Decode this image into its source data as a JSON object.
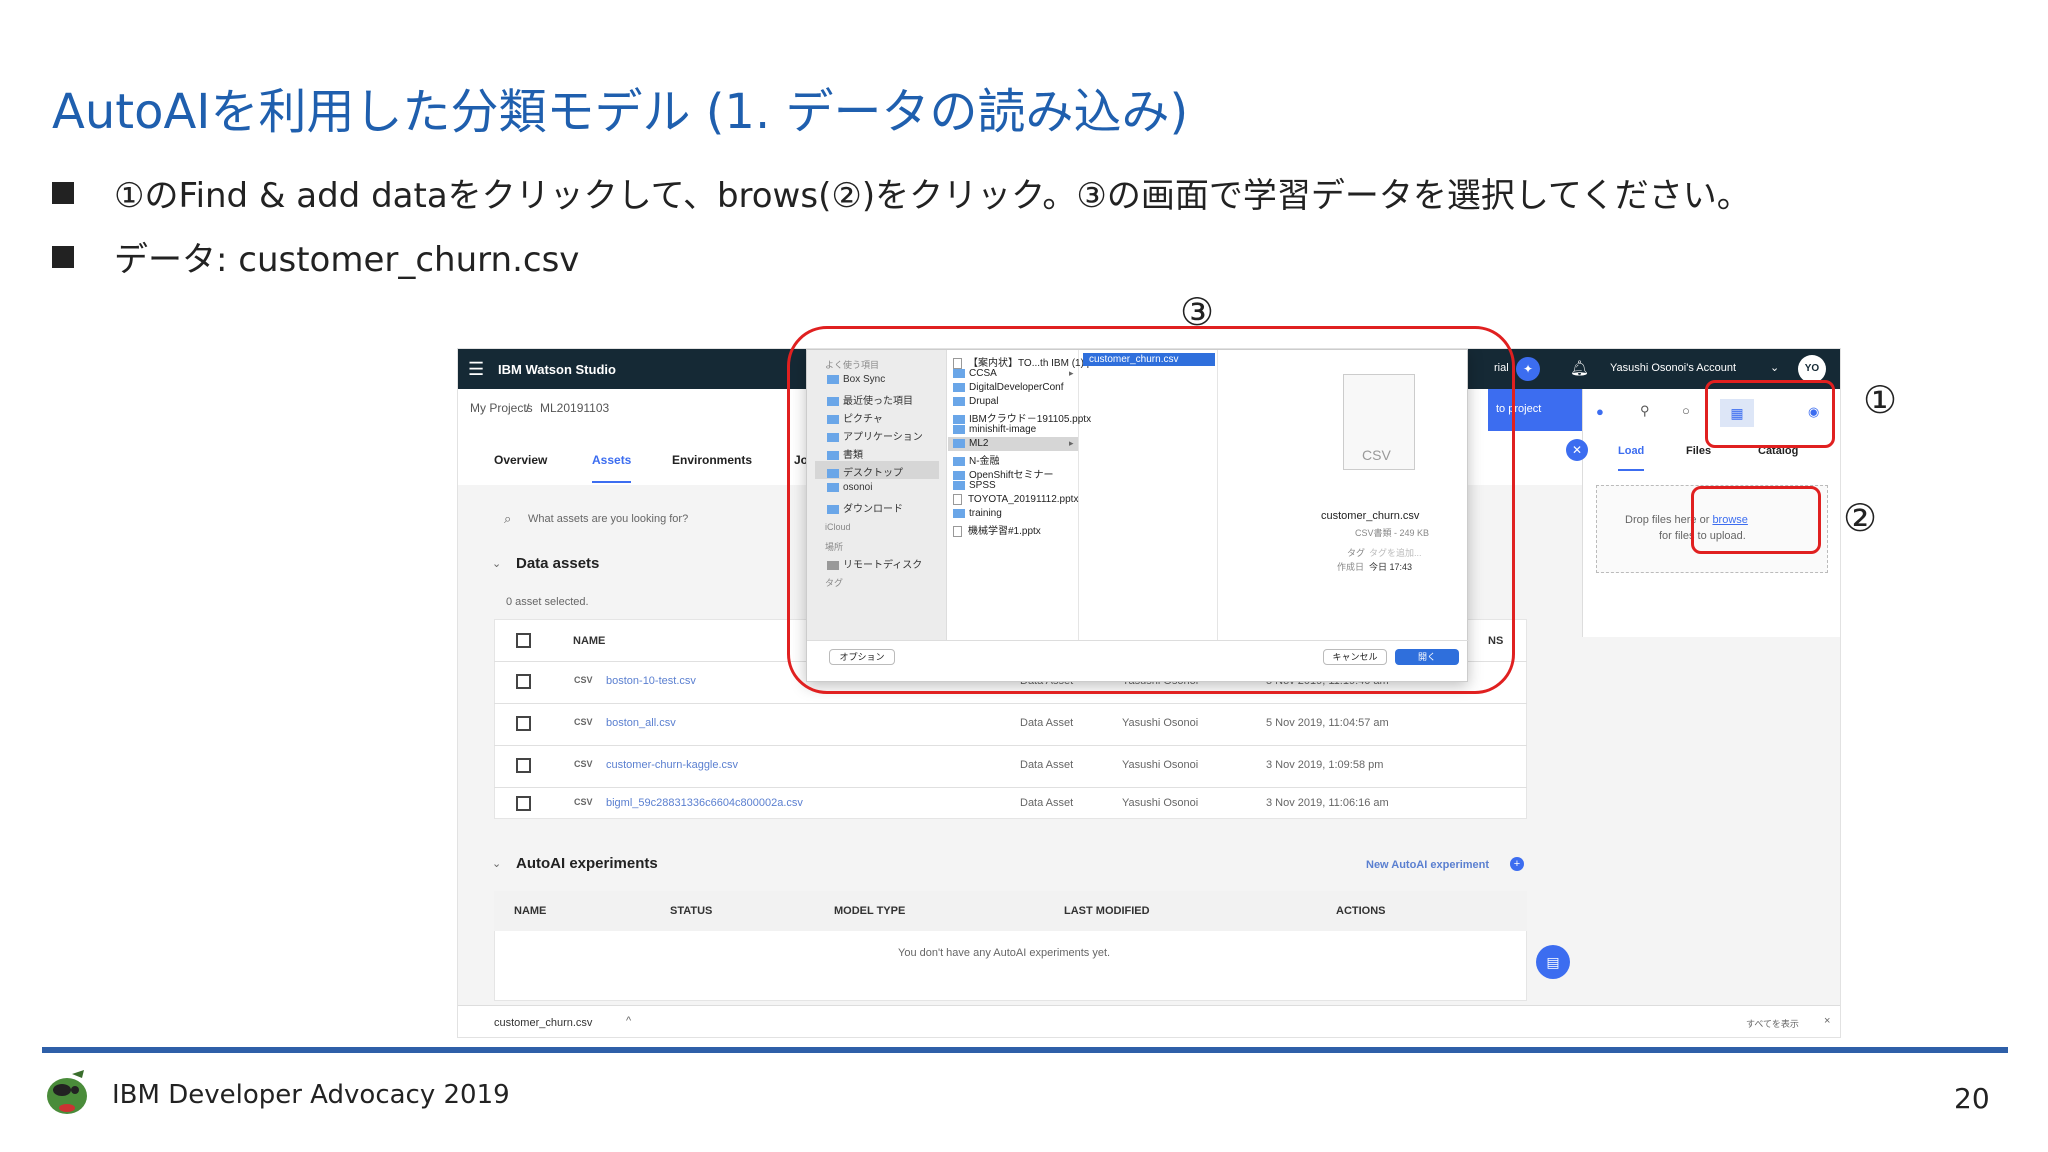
{
  "slide": {
    "title": "AutoAIを利用した分類モデル (1. データの読み込み)",
    "bullets": [
      "①のFind & add dataをクリックして、brows(②)をクリック。③の画面で学習データを選択してください。",
      "データ: customer_churn.csv"
    ],
    "annotations": {
      "one": "①",
      "two": "②",
      "three": "③"
    },
    "footer": "IBM Developer Advocacy 2019",
    "page_number": "20"
  },
  "watson": {
    "app_title": "IBM Watson Studio",
    "trial": "rial",
    "account": "Yasushi Osonoi's Account",
    "avatar": "YO",
    "breadcrumb_root": "My Projects",
    "breadcrumb_sep": "/",
    "breadcrumb_project": "ML20191103",
    "add_to_project": "to project",
    "tabs": [
      "Overview",
      "Assets",
      "Environments",
      "Jo"
    ],
    "search_placeholder": "What assets are you looking for?",
    "data_assets_heading": "Data assets",
    "selected_count": "0 asset selected.",
    "table_header_name": "NAME",
    "table_header_trunc": "NS",
    "rows": [
      {
        "type": "CSV",
        "name": "boston-10-test.csv",
        "kind": "Data Asset",
        "owner": "Yasushi Osonoi",
        "modified": "5 Nov 2019, 11:19:40 am"
      },
      {
        "type": "CSV",
        "name": "boston_all.csv",
        "kind": "Data Asset",
        "owner": "Yasushi Osonoi",
        "modified": "5 Nov 2019, 11:04:57 am"
      },
      {
        "type": "CSV",
        "name": "customer-churn-kaggle.csv",
        "kind": "Data Asset",
        "owner": "Yasushi Osonoi",
        "modified": "3 Nov 2019, 1:09:58 pm"
      },
      {
        "type": "CSV",
        "name": "bigml_59c28831336c6604c800002a.csv",
        "kind": "Data Asset",
        "owner": "Yasushi Osonoi",
        "modified": "3 Nov 2019, 11:06:16 am"
      }
    ],
    "autoai_heading": "AutoAI experiments",
    "new_autoai": "New AutoAI experiment",
    "autoai_headers": [
      "NAME",
      "STATUS",
      "MODEL TYPE",
      "LAST MODIFIED",
      "ACTIONS"
    ],
    "autoai_empty": "You don't have any AutoAI experiments yet.",
    "panel_tabs": [
      "Load",
      "Files",
      "Catalog"
    ],
    "drop_text_a": "Drop files here or",
    "browse": "browse",
    "drop_text_b": "for files to upload.",
    "download_file": "customer_churn.csv",
    "show_all": "すべてを表示",
    "close_x": "×"
  },
  "finder": {
    "sidebar_section_fav": "よく使う項目",
    "sidebar": [
      "Box Sync",
      "最近使った項目",
      "ピクチャ",
      "アプリケーション",
      "書類",
      "デスクトップ",
      "osonoi",
      "ダウンロード"
    ],
    "sidebar_section_cloud": "iCloud",
    "sidebar_section_place": "場所",
    "remote_disk": "リモートディスク",
    "sidebar_section_tag": "タグ",
    "files": [
      "【案内状】TO...th IBM (1).pdf",
      "CCSA",
      "DigitalDeveloperConf",
      "Drupal",
      "IBMクラウド－191105.pptx",
      "minishift-image",
      "ML2",
      "N-金融",
      "OpenShiftセミナー",
      "SPSS",
      "TOYOTA_20191112.pptx",
      "training",
      "機械学習#1.pptx"
    ],
    "selected_file": "customer_churn.csv",
    "preview_label": "CSV",
    "preview_name": "customer_churn.csv",
    "preview_meta": "CSV書類 - 249 KB",
    "tag_label": "タグ",
    "tag_value": "タグを追加...",
    "created_label": "作成日",
    "created_value": "今日 17:43",
    "options_button": "オプション",
    "cancel_button": "キャンセル",
    "open_button": "開く"
  }
}
